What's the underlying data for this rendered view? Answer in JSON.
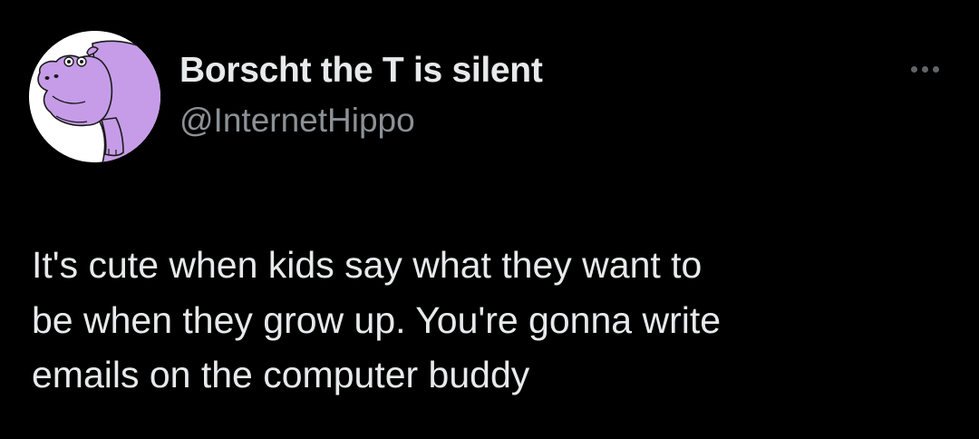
{
  "tweet": {
    "author": {
      "display_name": "Borscht the T is silent",
      "handle": "@InternetHippo",
      "avatar_icon": "purple-hippo-avatar"
    },
    "more_icon": "more-horizontal-icon",
    "text_lines": [
      "It's cute when kids say what they want to",
      "be when they grow up. You're gonna write",
      "emails on the computer buddy"
    ]
  },
  "colors": {
    "background": "#000000",
    "text_primary": "#e7e9ea",
    "text_secondary": "#8b9196",
    "avatar_purple": "#c69ce8"
  }
}
